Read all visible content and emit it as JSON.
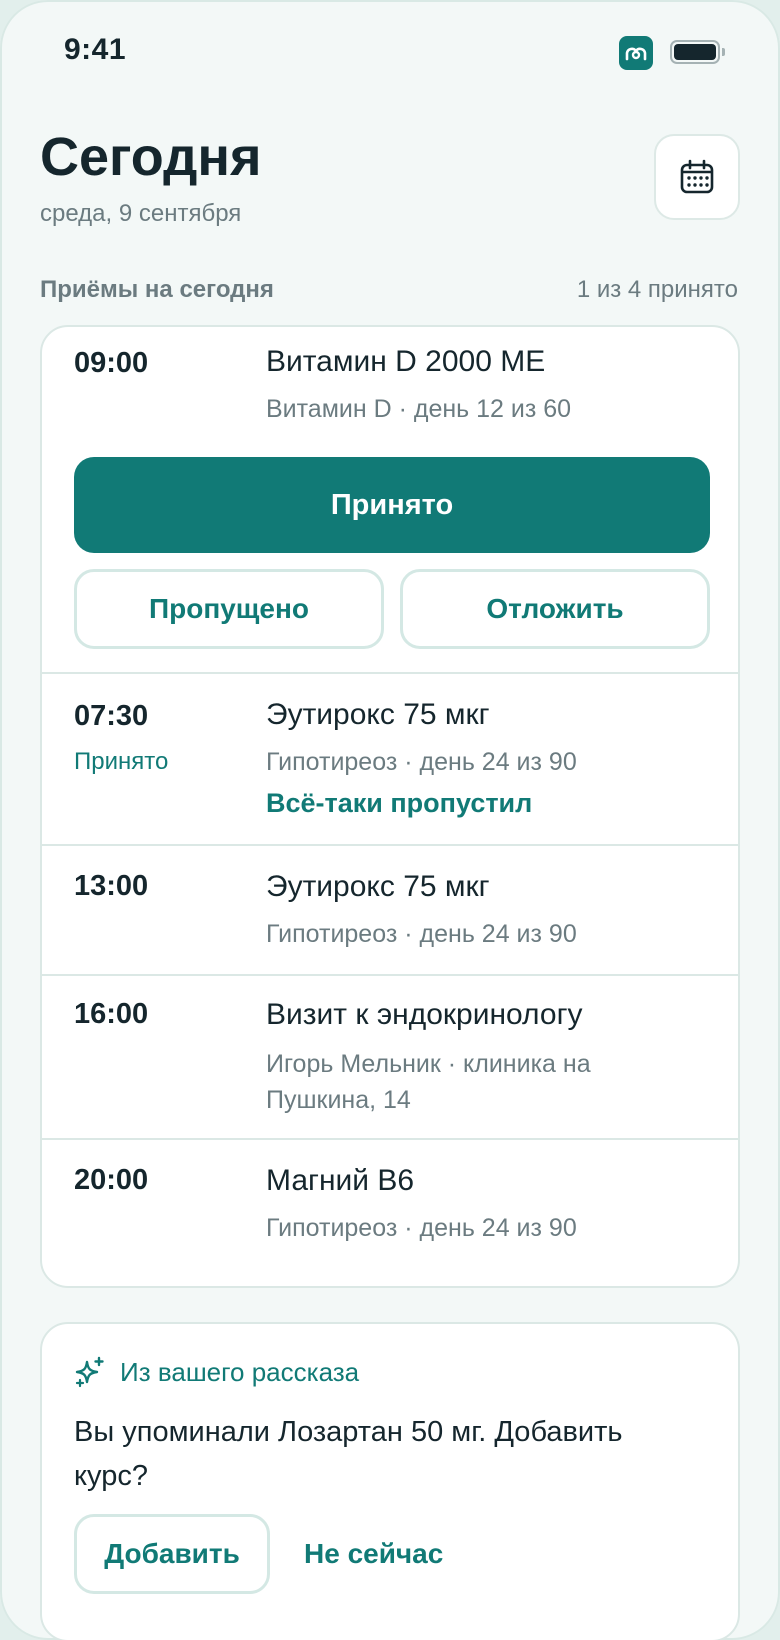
{
  "status_bar": {
    "time": "9:41"
  },
  "header": {
    "title": "Сегодня",
    "date": "среда, 9 сентября",
    "calendar_icon": "calendar-icon"
  },
  "section": {
    "label": "Приёмы на сегодня",
    "count": "1 из 4 принято"
  },
  "active_entry": {
    "time": "09:00",
    "title": "Витамин D 2000 МЕ",
    "subtitle": "Витамин D · день 12 из 60",
    "taken_label": "Принято",
    "missed_label": "Пропущено",
    "postpone_label": "Отложить"
  },
  "entries": [
    {
      "time": "07:30",
      "status": "Принято",
      "title": "Эутирокс 75 мкг",
      "subtitle": "Гипотиреоз · день 24 из 90",
      "link": "Всё-таки пропустил"
    },
    {
      "time": "13:00",
      "title": "Эутирокс 75 мкг",
      "subtitle": "Гипотиреоз · день 24 из 90"
    },
    {
      "time": "16:00",
      "title": "Визит к эндокринологу",
      "subtitle": "Игорь Мельник · клиника на Пушкина, 14"
    },
    {
      "time": "20:00",
      "title": "Магний B6",
      "subtitle": "Гипотиреоз · день 24 из 90"
    }
  ],
  "suggestion": {
    "label": "Из вашего рассказа",
    "icon": "sparkle-icon",
    "text": "Вы упоминали Лозартан 50 мг. Добавить курс?",
    "add_label": "Добавить",
    "later_label": "Не сейчас"
  },
  "colors": {
    "accent": "#117a76",
    "background": "#f3f8f7",
    "text": "#15262d",
    "muted": "#6b7b80"
  }
}
